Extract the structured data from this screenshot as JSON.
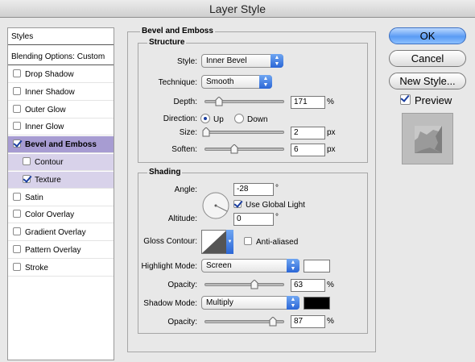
{
  "window": {
    "title": "Layer Style"
  },
  "styles_list": {
    "header": "Styles",
    "blending_options": "Blending Options: Custom",
    "items": [
      {
        "label": "Drop Shadow",
        "checked": false
      },
      {
        "label": "Inner Shadow",
        "checked": false
      },
      {
        "label": "Outer Glow",
        "checked": false
      },
      {
        "label": "Inner Glow",
        "checked": false
      },
      {
        "label": "Bevel and Emboss",
        "checked": true
      },
      {
        "label": "Contour",
        "checked": false
      },
      {
        "label": "Texture",
        "checked": true
      },
      {
        "label": "Satin",
        "checked": false
      },
      {
        "label": "Color Overlay",
        "checked": false
      },
      {
        "label": "Gradient Overlay",
        "checked": false
      },
      {
        "label": "Pattern Overlay",
        "checked": false
      },
      {
        "label": "Stroke",
        "checked": false
      }
    ]
  },
  "bevel": {
    "title": "Bevel and Emboss",
    "structure": {
      "title": "Structure",
      "style_label": "Style:",
      "style_value": "Inner Bevel",
      "technique_label": "Technique:",
      "technique_value": "Smooth",
      "depth_label": "Depth:",
      "depth_value": "171",
      "depth_unit": "%",
      "depth_level": 0.171,
      "direction_label": "Direction:",
      "direction_up": "Up",
      "direction_down": "Down",
      "direction_selected": "Up",
      "size_label": "Size:",
      "size_value": "2",
      "size_unit": "px",
      "size_level": 0.01,
      "soften_label": "Soften:",
      "soften_value": "6",
      "soften_unit": "px",
      "soften_level": 0.375
    },
    "shading": {
      "title": "Shading",
      "angle_label": "Angle:",
      "angle_value": "-28",
      "angle_unit": "°",
      "global_light_label": "Use Global Light",
      "global_light_checked": true,
      "altitude_label": "Altitude:",
      "altitude_value": "0",
      "altitude_unit": "°",
      "gloss_label": "Gloss Contour:",
      "anti_aliased_label": "Anti-aliased",
      "anti_aliased_checked": false,
      "highlight_mode_label": "Highlight Mode:",
      "highlight_mode_value": "Screen",
      "highlight_color": "#ffffff",
      "highlight_opacity_label": "Opacity:",
      "highlight_opacity_value": "63",
      "highlight_opacity_unit": "%",
      "highlight_opacity_level": 0.63,
      "shadow_mode_label": "Shadow Mode:",
      "shadow_mode_value": "Multiply",
      "shadow_color": "#000000",
      "shadow_opacity_label": "Opacity:",
      "shadow_opacity_value": "87",
      "shadow_opacity_unit": "%",
      "shadow_opacity_level": 0.87
    }
  },
  "buttons": {
    "ok": "OK",
    "cancel": "Cancel",
    "new_style": "New Style..."
  },
  "preview": {
    "label": "Preview",
    "checked": true
  }
}
